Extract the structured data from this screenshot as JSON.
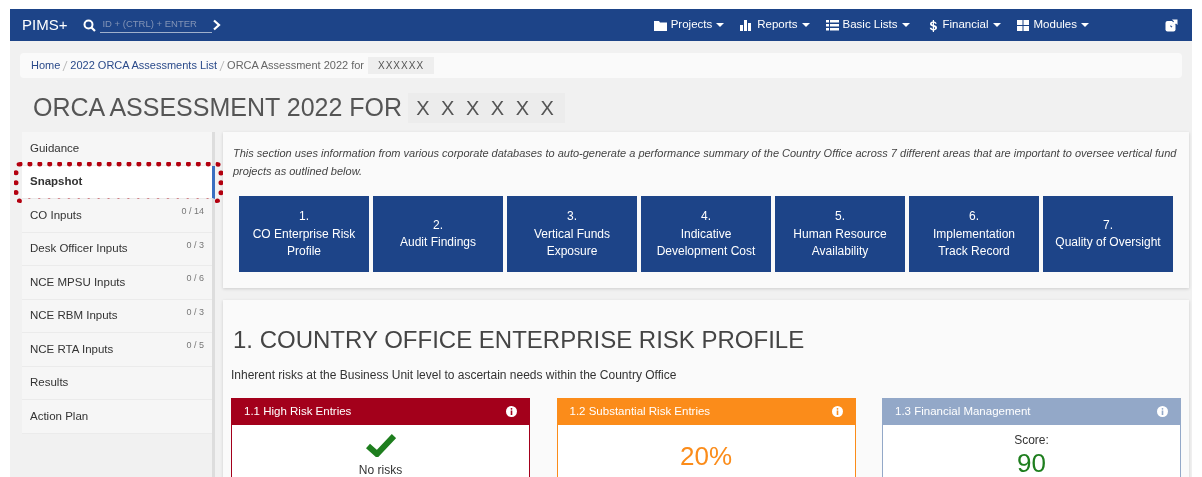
{
  "navbar": {
    "brand": "PIMS+",
    "search": {
      "placeholder": "ID + (CTRL) + ENTER"
    },
    "menus": [
      {
        "label": "Projects"
      },
      {
        "label": "Reports"
      },
      {
        "label": "Basic Lists"
      },
      {
        "label": "Financial"
      },
      {
        "label": "Modules"
      }
    ]
  },
  "breadcrumb": [
    {
      "label": "Home",
      "kind": "link"
    },
    {
      "label": "2022 ORCA Assessments List",
      "kind": "link"
    },
    {
      "label": "ORCA Assessment 2022 for",
      "kind": "current"
    },
    {
      "label": "XXXXXX",
      "kind": "redacted"
    }
  ],
  "page_title": {
    "text": "ORCA ASSESSMENT 2022 FOR",
    "redacted": "X X X X X X"
  },
  "sidebar": {
    "items": [
      {
        "label": "Guidance",
        "selected": false,
        "highlighted": false
      },
      {
        "label": "Snapshot",
        "selected": true,
        "highlighted": true
      },
      {
        "label": "CO Inputs",
        "count": "0 / 14",
        "selected": false,
        "highlighted": false
      },
      {
        "label": "Desk Officer Inputs",
        "count": "0 / 3",
        "selected": false,
        "highlighted": false
      },
      {
        "label": "NCE MPSU Inputs",
        "count": "0 / 6",
        "selected": false,
        "highlighted": false
      },
      {
        "label": "NCE RBM Inputs",
        "count": "0 / 3",
        "selected": false,
        "highlighted": false
      },
      {
        "label": "NCE RTA Inputs",
        "count": "0 / 5",
        "selected": false,
        "highlighted": false
      },
      {
        "label": "Results",
        "selected": false,
        "highlighted": false
      },
      {
        "label": "Action Plan",
        "selected": false,
        "highlighted": false
      }
    ]
  },
  "intro": "This section uses information from various corporate databases to auto-generate a performance summary of the Country Office across 7 different areas that are important to oversee vertical fund projects as outlined below.",
  "areas": [
    {
      "number": "1.",
      "label": "CO Enterprise Risk Profile"
    },
    {
      "number": "2.",
      "label": "Audit Findings"
    },
    {
      "number": "3.",
      "label": "Vertical Funds Exposure"
    },
    {
      "number": "4.",
      "label": "Indicative Development Cost"
    },
    {
      "number": "5.",
      "label": "Human Resource Availability"
    },
    {
      "number": "6.",
      "label": "Implementation Track Record"
    },
    {
      "number": "7.",
      "label": "Quality of Oversight"
    }
  ],
  "section": {
    "title": "1. COUNTRY OFFICE ENTERPRISE RISK PROFILE",
    "subtitle": "Inherent risks at the Business Unit level to ascertain needs within the Country Office",
    "cards": [
      {
        "title": "1.1 High Risk Entries",
        "color": "#a3001b",
        "kind": "check",
        "text": "No risks"
      },
      {
        "title": "1.2 Substantial Risk Entries",
        "color": "#fb8c1a",
        "kind": "percent",
        "value": "20%"
      },
      {
        "title": "1.3 Financial Management",
        "color": "#93a8c8",
        "kind": "score",
        "label": "Score:",
        "value": "90"
      }
    ]
  }
}
